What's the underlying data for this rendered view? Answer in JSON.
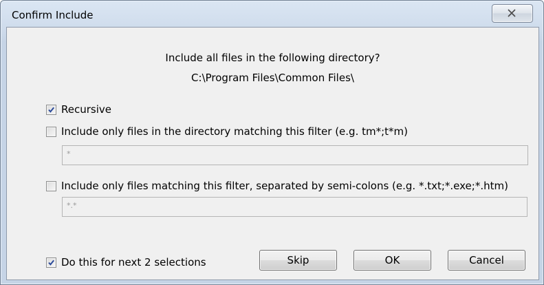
{
  "window": {
    "title": "Confirm Include"
  },
  "dialog": {
    "question": "Include all files in the following directory?",
    "directory": "C:\\Program Files\\Common Files\\",
    "recursive": {
      "label": "Recursive",
      "checked": true
    },
    "dir_filter": {
      "label": "Include only files in the directory matching this filter (e.g. tm*;t*m)",
      "checked": false,
      "value": "*"
    },
    "file_filter": {
      "label": "Include only files matching this filter, separated by semi-colons (e.g. *.txt;*.exe;*.htm)",
      "checked": false,
      "value": "*.*"
    },
    "repeat": {
      "label": "Do this for next 2 selections",
      "checked": true
    }
  },
  "buttons": {
    "skip": "Skip",
    "ok": "OK",
    "cancel": "Cancel"
  },
  "icons": {
    "close": "close-icon",
    "check": "checkmark-icon"
  },
  "colors": {
    "checkmark": "#2b4a9a",
    "title_gradient_top": "#dbe6f3",
    "client_bg": "#f0f0f0"
  }
}
